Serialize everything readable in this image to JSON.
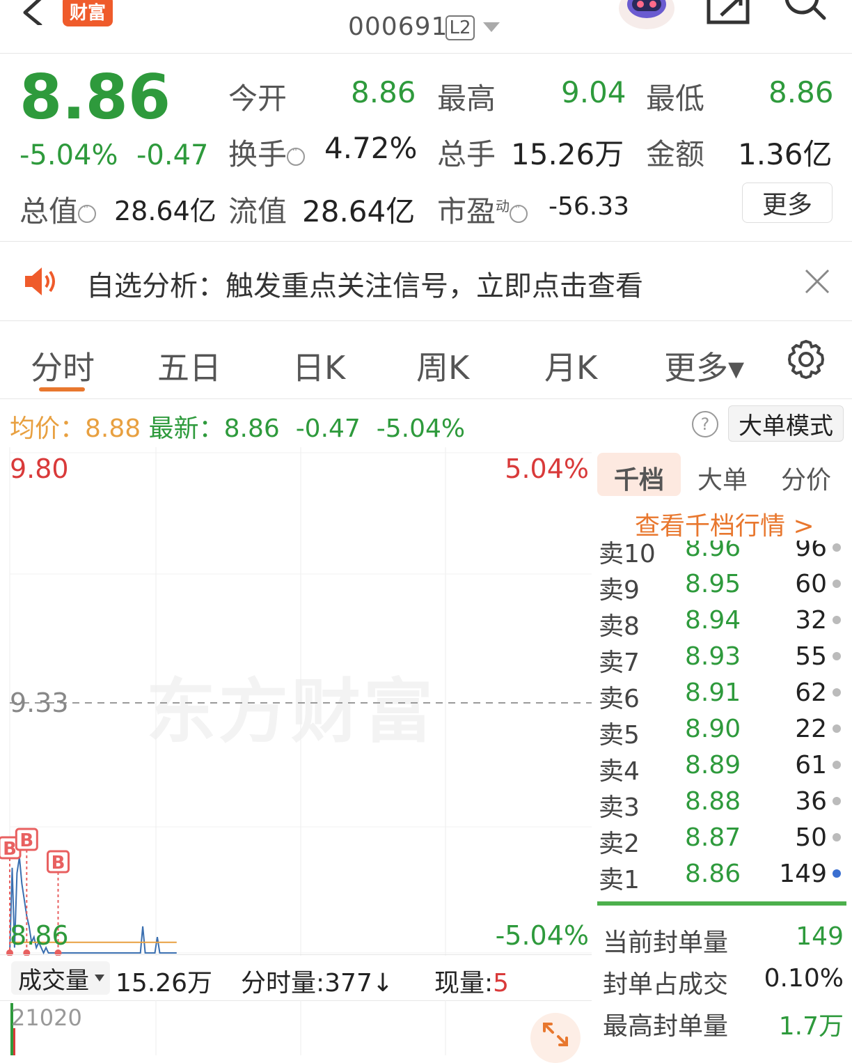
{
  "header": {
    "brand_badge": "财富",
    "stock_code": "000691",
    "level_badge": "L2"
  },
  "quote": {
    "price": "8.86",
    "pct_change": "-5.04%",
    "abs_change": "-0.47",
    "open_label": "今开",
    "open_value": "8.86",
    "high_label": "最高",
    "high_value": "9.04",
    "low_label": "最低",
    "low_value": "8.86",
    "turnover_label": "换手",
    "turnover_value": "4.72%",
    "volume_label": "总手",
    "volume_value": "15.26万",
    "amount_label": "金额",
    "amount_value": "1.36亿",
    "mktcap_label": "总值",
    "mktcap_value": "28.64亿",
    "float_label": "流值",
    "float_value": "28.64亿",
    "pe_label": "市盈",
    "pe_sup": "动",
    "pe_value": "-56.33",
    "more_label": "更多"
  },
  "banner": {
    "text": "自选分析：触发重点关注信号，立即点击查看"
  },
  "tabs": [
    {
      "label": "分时"
    },
    {
      "label": "五日"
    },
    {
      "label": "日K"
    },
    {
      "label": "周K"
    },
    {
      "label": "月K"
    },
    {
      "label": "更多▾"
    }
  ],
  "info_line": {
    "avg_label": "均价：",
    "avg_value": "8.88",
    "latest_label": "最新：",
    "latest_value": "8.86",
    "change": "-0.47",
    "pct": "-5.04%",
    "big_order_mode": "大单模式"
  },
  "chart_data": {
    "type": "line",
    "y_ticks_left": [
      "9.80",
      "9.33",
      "8.86"
    ],
    "y_ticks_right": [
      "5.04%",
      "-5.04%"
    ],
    "ylim": [
      8.86,
      9.8
    ],
    "reference_price": 9.33,
    "marker_label": "B",
    "series": [
      {
        "values": [
          8.86,
          9.02,
          8.87,
          9.01,
          9.04,
          8.99,
          8.96,
          8.93,
          8.91,
          8.88,
          8.89,
          8.87,
          8.88,
          8.87,
          8.86,
          8.87,
          8.86,
          8.86,
          8.86,
          8.86,
          8.86,
          8.86,
          8.86,
          8.86,
          8.86,
          8.86,
          8.86,
          8.86,
          8.86,
          8.86,
          8.86,
          8.86,
          8.86,
          8.86,
          8.86,
          8.86,
          8.86,
          8.86,
          8.86,
          8.86,
          8.86,
          8.86,
          8.86,
          8.86,
          8.86,
          8.86,
          8.86,
          8.86,
          8.86,
          8.86,
          8.86,
          8.86,
          8.86,
          8.86,
          8.86,
          8.91,
          8.86,
          8.86,
          8.86,
          8.86,
          8.86,
          8.89,
          8.86,
          8.86,
          8.86,
          8.86,
          8.86,
          8.86,
          8.86,
          8.86
        ]
      },
      {
        "values": [
          8.88,
          8.88,
          8.88,
          8.88,
          8.88,
          8.88,
          8.88,
          8.88,
          8.88,
          8.88,
          8.88,
          8.88,
          8.88,
          8.88,
          8.88,
          8.88,
          8.88,
          8.88,
          8.88,
          8.88,
          8.88,
          8.88,
          8.88,
          8.88,
          8.88,
          8.88,
          8.88,
          8.88,
          8.88,
          8.88,
          8.88,
          8.88,
          8.88,
          8.88,
          8.88,
          8.88,
          8.88,
          8.88,
          8.88,
          8.88,
          8.88,
          8.88,
          8.88,
          8.88,
          8.88,
          8.88,
          8.88,
          8.88,
          8.88,
          8.88,
          8.88,
          8.88,
          8.88,
          8.88,
          8.88,
          8.88,
          8.88,
          8.88,
          8.88,
          8.88,
          8.88,
          8.88,
          8.88,
          8.88,
          8.88,
          8.88,
          8.88,
          8.88,
          8.88,
          8.88
        ]
      }
    ],
    "total_points": 241
  },
  "volume": {
    "selector": "成交量",
    "total": "15.26万",
    "minute_volume": "分时量:377↓",
    "current_label": "现量:",
    "current_value": "5",
    "ytick": "21020"
  },
  "order_book": {
    "tabs": [
      "千档",
      "大单",
      "分价"
    ],
    "link": "查看千档行情 >",
    "asks": [
      {
        "label": "卖10",
        "price": "8.96",
        "qty": "96"
      },
      {
        "label": "卖9",
        "price": "8.95",
        "qty": "60"
      },
      {
        "label": "卖8",
        "price": "8.94",
        "qty": "32"
      },
      {
        "label": "卖7",
        "price": "8.93",
        "qty": "55"
      },
      {
        "label": "卖6",
        "price": "8.91",
        "qty": "62"
      },
      {
        "label": "卖5",
        "price": "8.90",
        "qty": "22"
      },
      {
        "label": "卖4",
        "price": "8.89",
        "qty": "61"
      },
      {
        "label": "卖3",
        "price": "8.88",
        "qty": "36"
      },
      {
        "label": "卖2",
        "price": "8.87",
        "qty": "50"
      },
      {
        "label": "卖1",
        "price": "8.86",
        "qty": "149"
      }
    ],
    "seal": [
      {
        "label": "当前封单量",
        "value": "149"
      },
      {
        "label": "封单占成交",
        "value": "0.10%"
      },
      {
        "label": "最高封单量",
        "value": "1.7万"
      }
    ]
  },
  "colors": {
    "up": "#d93a3a",
    "down": "#2e9a3c",
    "accent": "#e8772e",
    "price_line": "#3a6fb0",
    "avg_line": "#e8a040"
  },
  "icons": {
    "back": "chevron-left-icon",
    "robot": "robot-icon",
    "share": "share-icon",
    "search": "search-icon",
    "speaker": "speaker-icon",
    "close": "close-icon",
    "gear": "gear-icon",
    "help": "help-icon",
    "expand": "expand-icon"
  }
}
